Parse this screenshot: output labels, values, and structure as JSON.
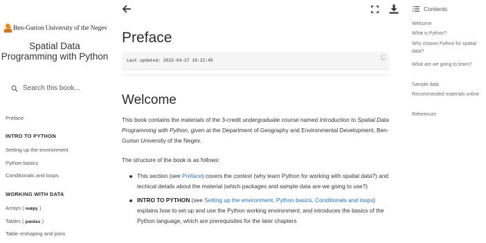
{
  "sidebar": {
    "logo_text": "Ben-Gurion University of the Negev",
    "book_title": "Spatial Data Programming with Python",
    "search_placeholder": "Search this book...",
    "nav": {
      "preface": "Preface",
      "caption_intro": "INTRO TO PYTHON",
      "setup": "Setting up the environment",
      "basics": "Python basics",
      "conditionals": "Conditionals and loops",
      "caption_working": "WORKING WITH DATA",
      "arrays_label": "Arrays (",
      "arrays_code": "numpy",
      "arrays_close": ")",
      "tables_label": "Tables (",
      "tables_code": "pandas",
      "tables_close": ")",
      "reshaping": "Table reshaping and joins"
    }
  },
  "icons": {
    "back": "arrow-left-icon",
    "fullscreen": "fullscreen-icon",
    "download": "download-icon",
    "copy": "copy-icon",
    "search": "search-icon",
    "contents": "list-icon"
  },
  "main": {
    "title": "Preface",
    "last_updated": "Last updated: 2022-04-27 18:22:45",
    "section_title": "Welcome",
    "para1_a": "This book contains the materials of the 3-credit undergraduate course named ",
    "para1_em": "Introduction to Spatial Data Programming with Python",
    "para1_b": ", given at the Department of Geography and Environmental Development, Ben-Gurion University of the Negev.",
    "para2": "The structure of the book is as follows:",
    "bullet1_a": "This section (see ",
    "bullet1_link": "Preface",
    "bullet1_b": ") covers the context (why learn Python for working with spatial data?) and techical details about the material (which packages and sample data are we going to use?)",
    "bullet2_bold": "INTRO TO PYTHON",
    "bullet2_a": " (see ",
    "bullet2_link": "Setting up the environment, Python basics, Conditionals and loops",
    "bullet2_b": ") explains how to set up and use the Python working environment, and introduces the basics of the Python language, which are prerequisites for the later chapters"
  },
  "toc": {
    "heading": "Contents",
    "items": [
      "Welcome",
      "What is Python?",
      "Why choose Python for spatial data?",
      "What are we going to learn?",
      "Sample data",
      "Recommended materials online",
      "References"
    ]
  },
  "colors": {
    "link": "#1f6fb2",
    "text": "#333333",
    "logo_orange": "#e8891c"
  }
}
